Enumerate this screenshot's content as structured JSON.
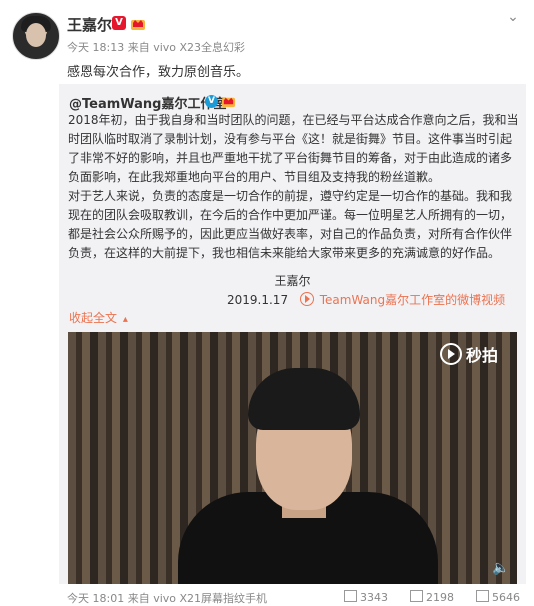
{
  "post": {
    "author": "王嘉尔",
    "meta_time": "今天 18:13",
    "meta_from": "来自",
    "meta_source": "vivo X23全息幻彩",
    "text": "感恩每次合作，致力原创音乐。"
  },
  "repost": {
    "author": "@TeamWang嘉尔工作室",
    "paragraph1": "2018年初，由于我自身和当时团队的问题，在已经与平台达成合作意向之后，我和当时团队临时取消了录制计划，没有参与平台《这！就是街舞》节目。这件事当时引起了非常不好的影响，并且也严重地干扰了平台街舞节目的筹备，对于由此造成的诸多负面影响，在此我郑重地向平台的用户、节目组及支持我的粉丝道歉。",
    "paragraph2": "对于艺人来说，负责的态度是一切合作的前提，遵守约定是一切合作的基础。我和我现在的团队会吸取教训，在今后的合作中更加严谨。每一位明星艺人所拥有的一切，都是社会公众所赐予的，因此更应当做好表率，对自己的作品负责，对所有合作伙伴负责，在这样的大前提下，我也相信未来能给大家带来更多的充满诚意的好作品。",
    "signature_name": "王嘉尔",
    "signature_date": "2019.1.17",
    "video_link": "TeamWang嘉尔工作室的微博视频",
    "collapse_label": "收起全文",
    "collapse_arrow": "▴",
    "video_watermark": "秒拍"
  },
  "footer": {
    "meta": "今天 18:01 来自 vivo X21屏幕指纹手机",
    "reposts": "3343",
    "comments": "2198",
    "likes": "5646"
  },
  "icons": {
    "more": "chevron-down-icon",
    "volume": "volume-icon"
  },
  "colors": {
    "accent": "#eb7350",
    "verified_red": "#e6162d",
    "verified_blue": "#1d9bd7",
    "repost_bg": "#f2f2f5"
  }
}
